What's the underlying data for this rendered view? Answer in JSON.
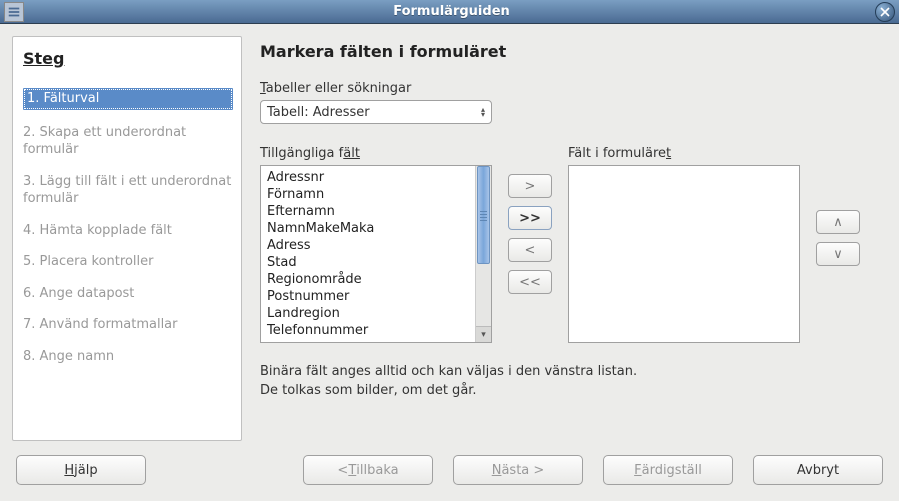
{
  "window": {
    "title": "Formulärguiden"
  },
  "sidebar": {
    "heading": "Steg",
    "items": [
      {
        "label": "1. Fälturval",
        "active": true
      },
      {
        "label": "2. Skapa ett underordnat formulär",
        "active": false
      },
      {
        "label": "3. Lägg till fält i ett underordnat formulär",
        "active": false
      },
      {
        "label": "4. Hämta kopplade fält",
        "active": false
      },
      {
        "label": "5. Placera kontroller",
        "active": false
      },
      {
        "label": "6. Ange datapost",
        "active": false
      },
      {
        "label": "7. Använd formatmallar",
        "active": false
      },
      {
        "label": "8. Ange namn",
        "active": false
      }
    ]
  },
  "main": {
    "heading": "Markera fälten i formuläret",
    "tables_label_pre": "T",
    "tables_label_rest": "abeller eller sökningar",
    "combo_value": "Tabell: Adresser",
    "available_label_pre": "Tillgängliga f",
    "available_label_rest": "ält",
    "inform_label_pre": "Fält i formuläre",
    "inform_label_rest": "t",
    "available_fields": [
      "Adressnr",
      "Förnamn",
      "Efternamn",
      "NamnMakeMaka",
      "Adress",
      "Stad",
      "Regionområde",
      "Postnummer",
      "Landregion",
      "Telefonnummer"
    ],
    "transfer": {
      "add": ">",
      "add_all": ">>",
      "remove": "<",
      "remove_all": "<<",
      "move_up": "∧",
      "move_down": "∨"
    },
    "note_line1": "Binära fält anges alltid och kan väljas i den vänstra listan.",
    "note_line2": "De tolkas som bilder, om det går."
  },
  "buttons": {
    "help_pre": "H",
    "help_rest": "jälp",
    "back_pre": "< ",
    "back_mid": "T",
    "back_rest": "illbaka",
    "next_pre": "N",
    "next_rest": "ästa >",
    "finish_pre": "F",
    "finish_rest": "ärdigställ",
    "cancel": "Avbryt"
  }
}
